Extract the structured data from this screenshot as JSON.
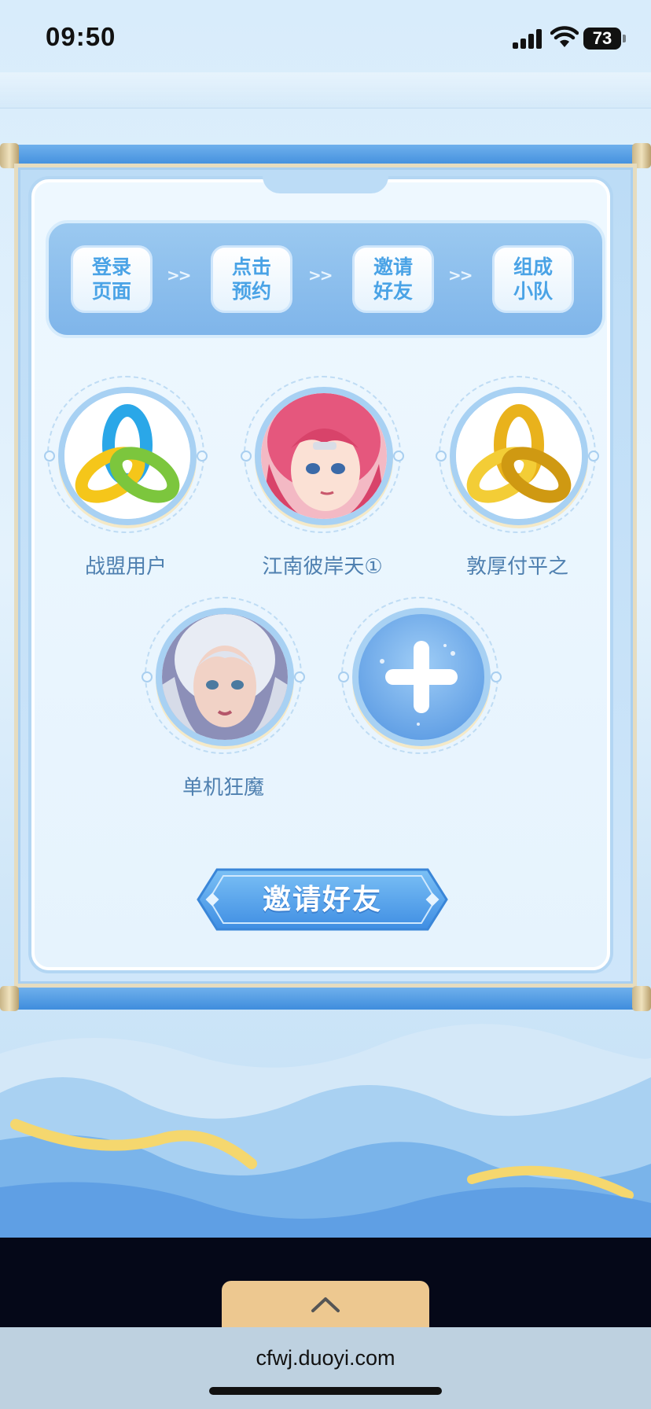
{
  "status_bar": {
    "time": "09:50",
    "battery": "73"
  },
  "steps": [
    {
      "label": "登录\n页面"
    },
    {
      "label": "点击\n预约"
    },
    {
      "label": "邀请\n好友"
    },
    {
      "label": "组成\n小队"
    }
  ],
  "step_separator": ">>",
  "members": [
    {
      "name": "战盟用户",
      "avatar": "tri-ring-icon-colorful"
    },
    {
      "name": "江南彼岸天①",
      "avatar": "pink-hair-hero-portrait"
    },
    {
      "name": "敦厚付平之",
      "avatar": "tri-ring-icon-gold"
    },
    {
      "name": "单机狂魔",
      "avatar": "white-hair-heroine-portrait"
    }
  ],
  "add_member": {
    "icon": "plus-icon"
  },
  "invite_button": {
    "label": "邀请好友"
  },
  "back_to_top": {
    "icon": "chevron-up-icon"
  },
  "browser": {
    "url": "cfwj.duoyi.com"
  },
  "colors": {
    "accent": "#4aa3e6",
    "button": "#5aa8ee",
    "back_to_top": "#edc890"
  }
}
